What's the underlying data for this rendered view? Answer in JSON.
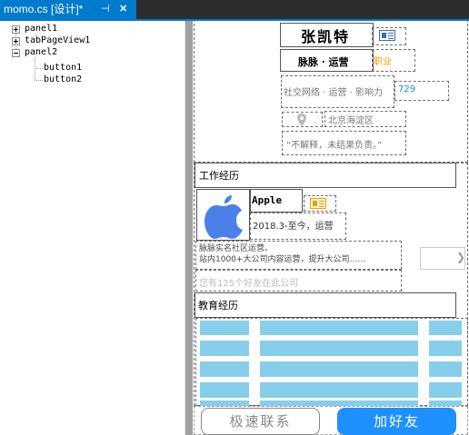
{
  "tab": {
    "title": "momo.cs [设计]*",
    "pin_glyph": "⊣",
    "close_glyph": "✕"
  },
  "tree": {
    "nodes": [
      {
        "label": "panel1",
        "expanded": false
      },
      {
        "label": "tabPageView1",
        "expanded": false
      },
      {
        "label": "panel2",
        "expanded": true,
        "children": [
          "button1",
          "button2"
        ]
      }
    ]
  },
  "profile": {
    "name": "张凯特",
    "role": "脉脉 · 运营",
    "job_tag": "职业",
    "tags": "社交网络 · 运营 · 影响力",
    "tag_count": "729",
    "location": "北京海淀区",
    "motto": "“不解释，未结果负责。”"
  },
  "work": {
    "section_title": "工作经历",
    "company": "Apple",
    "period": "2018.3-至今，运营",
    "description_line1": "脉脉实名社区运营。",
    "description_line2": "站内1000+大公司内容运营，提升大公司……",
    "friends": "您有125个好友在此公司",
    "chevron": "❯"
  },
  "education": {
    "section_title": "教育经历"
  },
  "actions": {
    "fast_contact": "极速联系",
    "add_friend": "加好友"
  },
  "colors": {
    "accent": "#007acc",
    "add_button": "#1e90ff",
    "gallery": "#87ceeb",
    "orange": "#e8a000",
    "blue": "#1e90c8"
  },
  "icons": {
    "card": "id-card-icon",
    "location": "map-pin-icon",
    "logo": "apple-logo"
  }
}
